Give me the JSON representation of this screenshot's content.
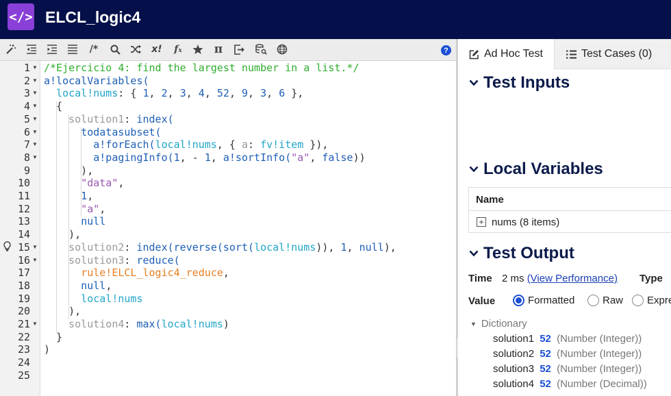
{
  "app": {
    "title": "ELCL_logic4",
    "logo_glyph": "</>"
  },
  "toolbar": {
    "icons": [
      "magic-wand-icon",
      "outdent-icon",
      "indent-icon",
      "list-icon",
      "comment-icon",
      "search-icon",
      "shuffle-icon",
      "x-factorial-icon",
      "function-icon",
      "star-icon",
      "pi-icon",
      "export-icon",
      "database-search-icon",
      "globe-icon"
    ],
    "comment_glyph": "/*",
    "x_glyph": "x!",
    "fx_glyph": "f",
    "pi_glyph": "π",
    "help_glyph": "?"
  },
  "editor": {
    "line_numbers": [
      "1",
      "2",
      "3",
      "4",
      "5",
      "6",
      "7",
      "8",
      "9",
      "10",
      "11",
      "12",
      "13",
      "14",
      "15",
      "16",
      "17",
      "18",
      "19",
      "20",
      "21",
      "22",
      "23",
      "24",
      "25"
    ],
    "lines": [
      [
        {
          "t": "/*Ejercicio 4: find the largest number in a list.*/",
          "c": "c-comment"
        }
      ],
      [
        {
          "t": "a!localVariables(",
          "c": "c-fn"
        }
      ],
      [
        {
          "t": "  ",
          "c": "c-punc"
        },
        {
          "t": "local!nums",
          "c": "c-var"
        },
        {
          "t": ": { ",
          "c": "c-punc"
        },
        {
          "t": "1",
          "c": "c-num"
        },
        {
          "t": ", ",
          "c": "c-punc"
        },
        {
          "t": "2",
          "c": "c-num"
        },
        {
          "t": ", ",
          "c": "c-punc"
        },
        {
          "t": "3",
          "c": "c-num"
        },
        {
          "t": ", ",
          "c": "c-punc"
        },
        {
          "t": "4",
          "c": "c-num"
        },
        {
          "t": ", ",
          "c": "c-punc"
        },
        {
          "t": "52",
          "c": "c-num"
        },
        {
          "t": ", ",
          "c": "c-punc"
        },
        {
          "t": "9",
          "c": "c-num"
        },
        {
          "t": ", ",
          "c": "c-punc"
        },
        {
          "t": "3",
          "c": "c-num"
        },
        {
          "t": ", ",
          "c": "c-punc"
        },
        {
          "t": "6",
          "c": "c-num"
        },
        {
          "t": " },",
          "c": "c-punc"
        }
      ],
      [
        {
          "t": "  {",
          "c": "c-punc"
        }
      ],
      [
        {
          "t": "    ",
          "c": "c-punc"
        },
        {
          "t": "solution1",
          "c": "c-key"
        },
        {
          "t": ": ",
          "c": "c-punc"
        },
        {
          "t": "index(",
          "c": "c-fn"
        }
      ],
      [
        {
          "t": "      ",
          "c": "c-punc"
        },
        {
          "t": "todatasubset(",
          "c": "c-fn"
        }
      ],
      [
        {
          "t": "        ",
          "c": "c-punc"
        },
        {
          "t": "a!forEach(",
          "c": "c-fn"
        },
        {
          "t": "local!nums",
          "c": "c-var"
        },
        {
          "t": ", { ",
          "c": "c-punc"
        },
        {
          "t": "a",
          "c": "c-key"
        },
        {
          "t": ": ",
          "c": "c-punc"
        },
        {
          "t": "fv!item",
          "c": "c-var"
        },
        {
          "t": " }),",
          "c": "c-punc"
        }
      ],
      [
        {
          "t": "        ",
          "c": "c-punc"
        },
        {
          "t": "a!pagingInfo(",
          "c": "c-fn"
        },
        {
          "t": "1",
          "c": "c-num"
        },
        {
          "t": ", - ",
          "c": "c-punc"
        },
        {
          "t": "1",
          "c": "c-num"
        },
        {
          "t": ", ",
          "c": "c-punc"
        },
        {
          "t": "a!sortInfo(",
          "c": "c-fn"
        },
        {
          "t": "\"a\"",
          "c": "c-str"
        },
        {
          "t": ", ",
          "c": "c-punc"
        },
        {
          "t": "false",
          "c": "c-fn"
        },
        {
          "t": "))",
          "c": "c-punc"
        }
      ],
      [
        {
          "t": "      ),",
          "c": "c-punc"
        }
      ],
      [
        {
          "t": "      ",
          "c": "c-punc"
        },
        {
          "t": "\"data\"",
          "c": "c-str"
        },
        {
          "t": ",",
          "c": "c-punc"
        }
      ],
      [
        {
          "t": "      ",
          "c": "c-punc"
        },
        {
          "t": "1",
          "c": "c-num"
        },
        {
          "t": ",",
          "c": "c-punc"
        }
      ],
      [
        {
          "t": "      ",
          "c": "c-punc"
        },
        {
          "t": "\"a\"",
          "c": "c-str"
        },
        {
          "t": ",",
          "c": "c-punc"
        }
      ],
      [
        {
          "t": "      ",
          "c": "c-punc"
        },
        {
          "t": "null",
          "c": "c-null"
        }
      ],
      [
        {
          "t": "    ),",
          "c": "c-punc"
        }
      ],
      [
        {
          "t": "    ",
          "c": "c-punc"
        },
        {
          "t": "solution2",
          "c": "c-key"
        },
        {
          "t": ": ",
          "c": "c-punc"
        },
        {
          "t": "index(reverse(sort(",
          "c": "c-fn"
        },
        {
          "t": "local!nums",
          "c": "c-var"
        },
        {
          "t": ")), ",
          "c": "c-punc"
        },
        {
          "t": "1",
          "c": "c-num"
        },
        {
          "t": ", ",
          "c": "c-punc"
        },
        {
          "t": "null",
          "c": "c-null"
        },
        {
          "t": "),",
          "c": "c-punc"
        }
      ],
      [
        {
          "t": "    ",
          "c": "c-punc"
        },
        {
          "t": "solution3",
          "c": "c-key"
        },
        {
          "t": ": ",
          "c": "c-punc"
        },
        {
          "t": "reduce(",
          "c": "c-fn"
        }
      ],
      [
        {
          "t": "      ",
          "c": "c-punc"
        },
        {
          "t": "rule!ELCL_logic4_reduce",
          "c": "c-rule"
        },
        {
          "t": ",",
          "c": "c-punc"
        }
      ],
      [
        {
          "t": "      ",
          "c": "c-punc"
        },
        {
          "t": "null",
          "c": "c-null"
        },
        {
          "t": ",",
          "c": "c-punc"
        }
      ],
      [
        {
          "t": "      ",
          "c": "c-punc"
        },
        {
          "t": "local!nums",
          "c": "c-var"
        }
      ],
      [
        {
          "t": "    ),",
          "c": "c-punc"
        }
      ],
      [
        {
          "t": "    ",
          "c": "c-punc"
        },
        {
          "t": "solution4",
          "c": "c-key"
        },
        {
          "t": ": ",
          "c": "c-punc"
        },
        {
          "t": "max(",
          "c": "c-fn"
        },
        {
          "t": "local!nums",
          "c": "c-var"
        },
        {
          "t": ")",
          "c": "c-punc"
        }
      ],
      [
        {
          "t": "  }",
          "c": "c-punc"
        }
      ],
      [
        {
          "t": ")",
          "c": "c-punc"
        }
      ],
      [],
      []
    ],
    "fold_lines": [
      "1",
      "2",
      "3",
      "4",
      "5",
      "6",
      "7",
      "8",
      "15",
      "16",
      "21"
    ],
    "bulb_line": "15"
  },
  "panel": {
    "tabs": [
      {
        "label": "Ad Hoc Test",
        "icon": "edit-icon",
        "active": true
      },
      {
        "label": "Test Cases (0)",
        "icon": "list-icon",
        "active": false
      }
    ],
    "test_inputs_title": "Test Inputs",
    "local_variables_title": "Local Variables",
    "table_header": "Name",
    "table_row": "nums (8 items)",
    "test_output_title": "Test Output",
    "time_label": "Time",
    "time_value": "2 ms",
    "time_link": "(View Performance)",
    "type_label": "Type",
    "value_label": "Value",
    "radio_options": [
      {
        "label": "Formatted",
        "selected": true
      },
      {
        "label": "Raw",
        "selected": false
      },
      {
        "label": "Expre",
        "selected": false
      }
    ],
    "dictionary_label": "Dictionary",
    "solutions": [
      {
        "name": "solution1",
        "value": "52",
        "type": "(Number (Integer))"
      },
      {
        "name": "solution2",
        "value": "52",
        "type": "(Number (Integer))"
      },
      {
        "name": "solution3",
        "value": "52",
        "type": "(Number (Integer))"
      },
      {
        "name": "solution4",
        "value": "52",
        "type": "(Number (Decimal))"
      }
    ]
  },
  "colors": {
    "header_bg": "#05104a",
    "logo_bg": "#8a3fd8",
    "accent": "#1c4fd6",
    "section_title": "#0b1a4a"
  }
}
